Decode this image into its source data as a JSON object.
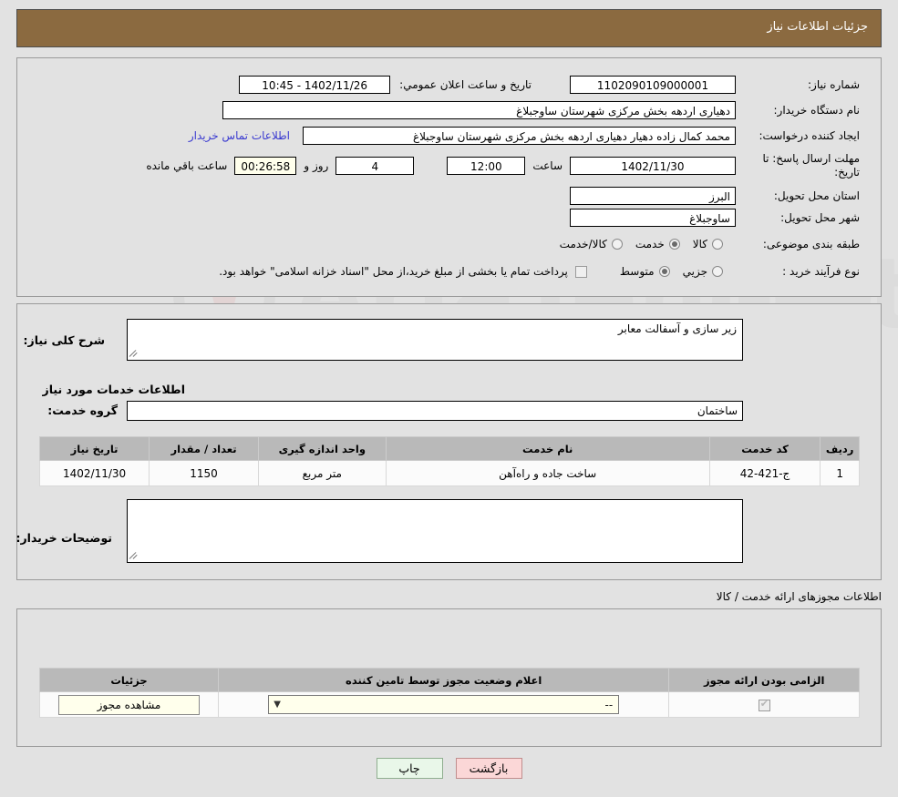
{
  "header": {
    "title": "جزئیات اطلاعات نیاز"
  },
  "top": {
    "need_number_label": "شماره نیاز:",
    "need_number_value": "1102090109000001",
    "announce_label": "تاریخ و ساعت اعلان عمومي:",
    "announce_value": "1402/11/26 - 10:45",
    "buyer_org_label": "نام دستگاه خریدار:",
    "buyer_org_value": "دهیاری اردهه بخش مرکزی شهرستان ساوجبلاغ",
    "creator_label": "ایجاد کننده درخواست:",
    "creator_value": "محمد کمال زاده دهیار دهیاری اردهه بخش مرکزی شهرستان ساوجبلاغ",
    "contact_link": "اطلاعات تماس خریدار",
    "deadline_label": "مهلت ارسال پاسخ: تا تاریخ:",
    "deadline_date": "1402/11/30",
    "hour_label": "ساعت",
    "deadline_time": "12:00",
    "days_value": "4",
    "days_label": "روز و",
    "countdown_value": "00:26:58",
    "remaining_label": "ساعت باقي مانده",
    "province_label": "استان محل تحویل:",
    "province_value": "البرز",
    "city_label": "شهر محل تحویل:",
    "city_value": "ساوجبلاغ",
    "category_label": "طبقه بندی موضوعی:",
    "category_options": [
      {
        "label": "کالا",
        "selected": false
      },
      {
        "label": "خدمت",
        "selected": true
      },
      {
        "label": "کالا/خدمت",
        "selected": false
      }
    ],
    "process_label": "نوع فرآیند خرید :",
    "process_options": [
      {
        "label": "جزيي",
        "selected": false
      },
      {
        "label": "متوسط",
        "selected": true
      }
    ],
    "treasury_checkbox_checked": false,
    "treasury_note": "پرداخت تمام یا بخشی از مبلغ خرید،از محل \"اسناد خزانه اسلامی\" خواهد بود."
  },
  "mid": {
    "summary_label": "شرح کلی نیاز:",
    "summary_value": "زیر سازی و آسفالت معابر",
    "services_caption": "اطلاعات خدمات مورد نیاز",
    "service_group_label": "گروه خدمت:",
    "service_group_value": "ساختمان",
    "table": {
      "headers": [
        "ردیف",
        "کد خدمت",
        "نام خدمت",
        "واحد اندازه گیری",
        "تعداد / مقدار",
        "تاریخ نیاز"
      ],
      "rows": [
        [
          "1",
          "ج-421-42",
          "ساخت جاده و راه‌آهن",
          "متر مربع",
          "1150",
          "1402/11/30"
        ]
      ]
    },
    "buyer_notes_label": "توضیحات خریدار:",
    "buyer_notes_value": ""
  },
  "permits": {
    "caption": "اطلاعات مجوزهای ارائه خدمت / کالا",
    "table": {
      "headers": [
        "الزامی بودن ارائه مجوز",
        "اعلام وضعیت مجوز توسط تامین کننده",
        "جزئیات"
      ],
      "rows": [
        {
          "required_checked": true,
          "status_value": "--",
          "details_button": "مشاهده مجوز"
        }
      ]
    }
  },
  "footer": {
    "print_label": "چاپ",
    "back_label": "بازگشت"
  },
  "colors": {
    "header_brown": "#8b6a40",
    "page_bg": "#e2e2e2",
    "link_blue": "#3a3ad0",
    "cream": "#ffffec",
    "print_green": "#e9f7e9",
    "back_pink": "#fbd7d7"
  }
}
